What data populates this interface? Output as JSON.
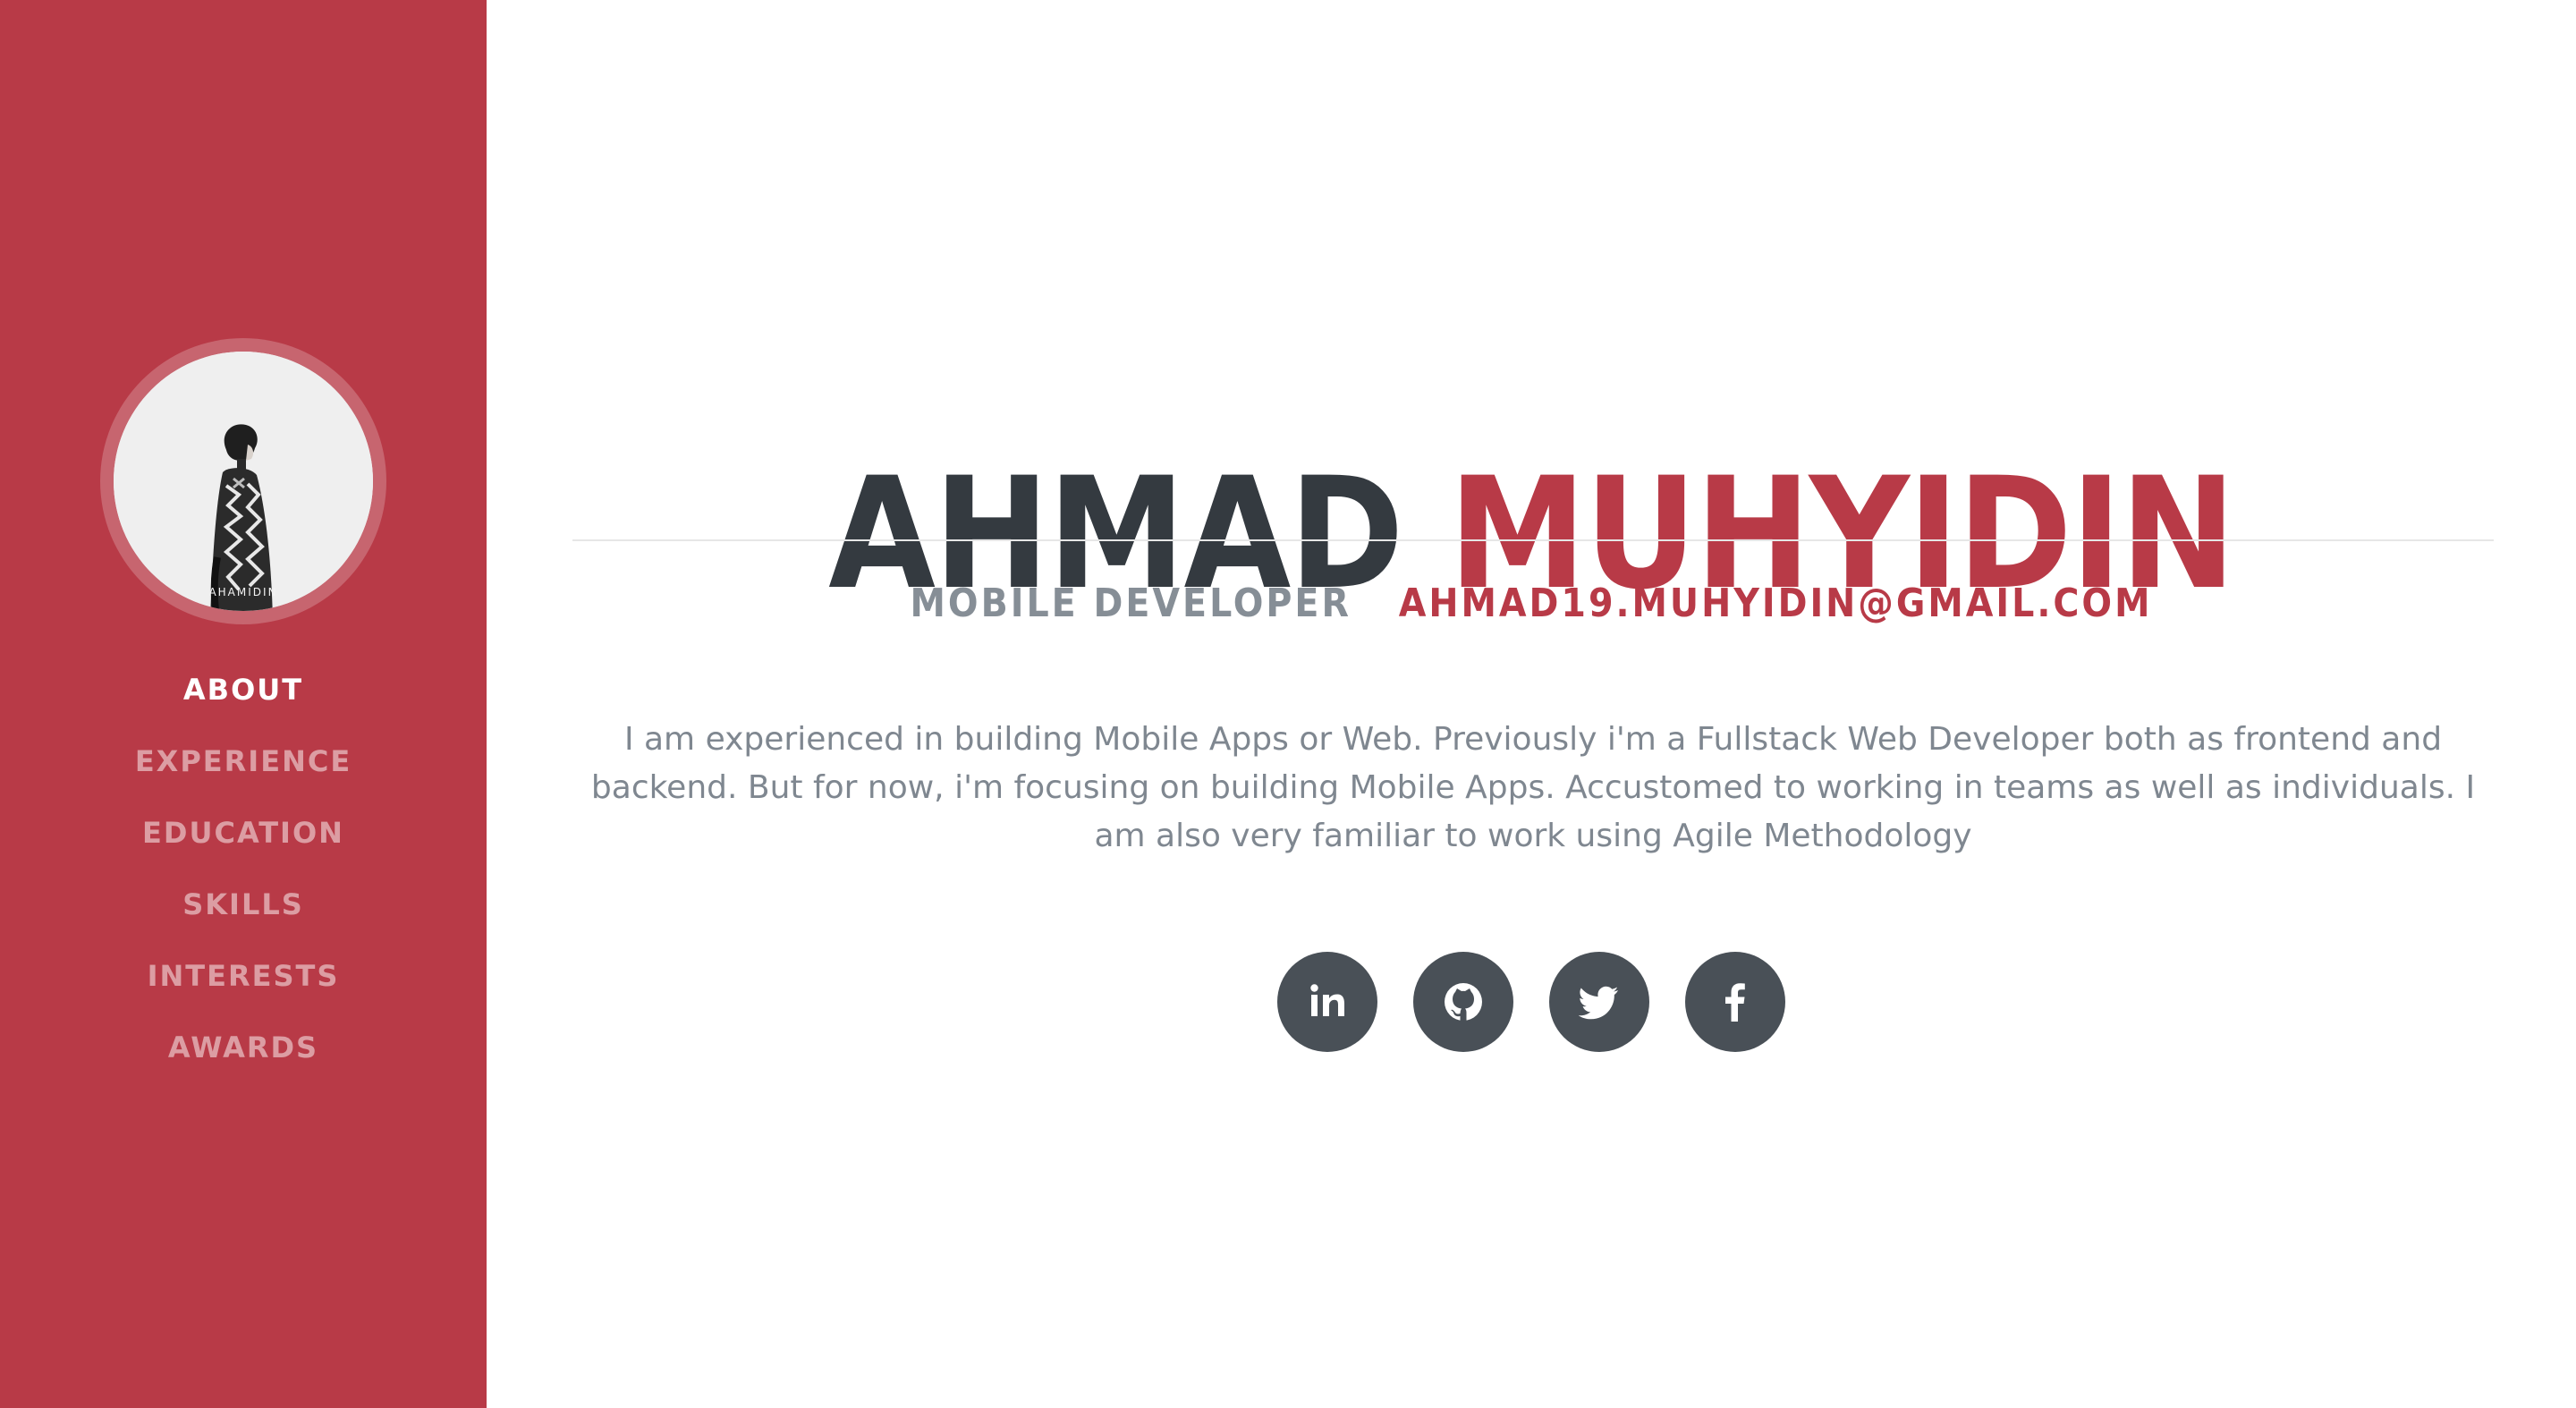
{
  "colors": {
    "primary": "#b83a47",
    "heading": "#343a40",
    "muted": "#868e96",
    "icon_bg": "#495057"
  },
  "sidebar": {
    "avatar": {
      "description_icon": "profile-photo",
      "logo_text": "AHAMIDIN"
    },
    "nav": [
      {
        "label": "ABOUT",
        "active": true
      },
      {
        "label": "EXPERIENCE",
        "active": false
      },
      {
        "label": "EDUCATION",
        "active": false
      },
      {
        "label": "SKILLS",
        "active": false
      },
      {
        "label": "INTERESTS",
        "active": false
      },
      {
        "label": "AWARDS",
        "active": false
      }
    ]
  },
  "about": {
    "first_name": "AHMAD",
    "last_name": "MUHYIDIN",
    "role": "MOBILE DEVELOPER",
    "email": "AHMAD19.MUHYIDIN@GMAIL.COM",
    "bio": "I am experienced in building Mobile Apps or Web. Previously i'm a Fullstack Web Developer both as frontend and backend. But for now, i'm focusing on building Mobile Apps. Accustomed to working in teams as well as individuals. I am also very familiar to work using Agile Methodology"
  },
  "social": [
    {
      "icon": "linkedin-icon"
    },
    {
      "icon": "github-icon"
    },
    {
      "icon": "twitter-icon"
    },
    {
      "icon": "facebook-icon"
    }
  ]
}
